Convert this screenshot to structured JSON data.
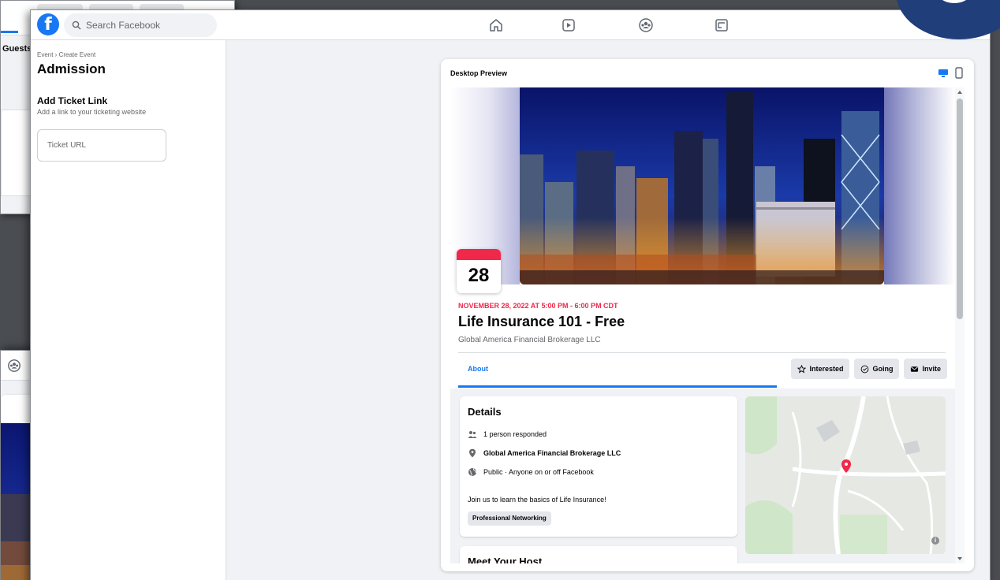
{
  "background_window_top": {
    "tab_label": "Guests"
  },
  "topbar": {
    "logo": "f",
    "search_placeholder": "Search Facebook",
    "nav": [
      "home-icon",
      "watch-icon",
      "groups-icon",
      "gaming-icon"
    ]
  },
  "left_panel": {
    "breadcrumb": "Event › Create Event",
    "title": "Admission",
    "section_title": "Add Ticket Link",
    "section_subtitle": "Add a link to your ticketing website",
    "ticket_placeholder": "Ticket URL"
  },
  "preview": {
    "label": "Desktop Preview",
    "calendar_day": "28",
    "event_date": "NOVEMBER 28, 2022 AT 5:00 PM - 6:00 PM CDT",
    "event_title": "Life Insurance 101 - Free",
    "organizer": "Global America Financial Brokerage LLC",
    "tab_about": "About",
    "actions": {
      "interested": "Interested",
      "going": "Going",
      "invite": "Invite"
    },
    "details": {
      "title": "Details",
      "responded": "1 person responded",
      "organizer": "Global America Financial Brokerage LLC",
      "privacy": "Public · Anyone on or off Facebook",
      "description": "Join us to learn the basics of Life Insurance!",
      "tag": "Professional Networking"
    },
    "host_title": "Meet Your Host"
  },
  "colors": {
    "facebook_blue": "#1877f2",
    "date_red": "#f02849",
    "badge_navy": "#1f3e7a"
  }
}
